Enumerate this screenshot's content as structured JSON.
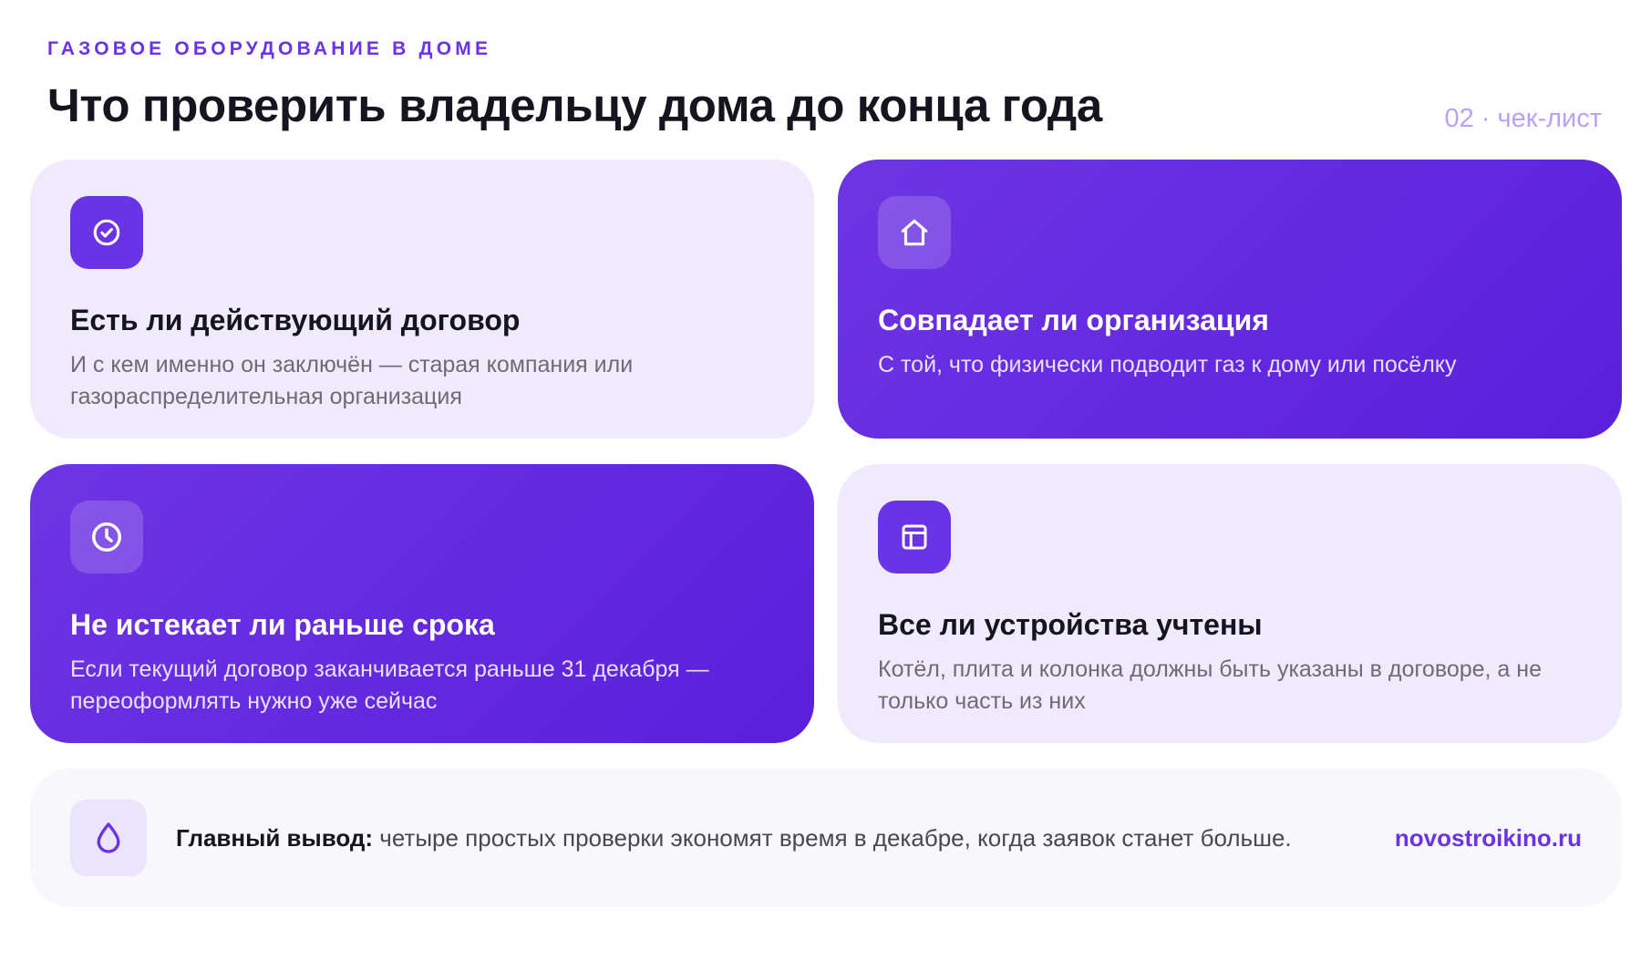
{
  "header": {
    "kicker": "ГАЗОВОЕ ОБОРУДОВАНИЕ В ДОМЕ",
    "title": "Что проверить владельцу дома до конца года",
    "page_indicator": "02 · чек-лист"
  },
  "cards": [
    {
      "icon": "check-circle-icon",
      "title": "Есть ли действующий договор",
      "description": "И с кем именно он заключён — старая компания или газораспределительная организация"
    },
    {
      "icon": "home-icon",
      "title": "Совпадает ли организация",
      "description": "С той, что физически подводит газ к дому или посёлку"
    },
    {
      "icon": "clock-icon",
      "title": "Не истекает ли раньше срока",
      "description": "Если текущий договор заканчивается раньше 31 декабря — переоформлять нужно уже сейчас"
    },
    {
      "icon": "layout-icon",
      "title": "Все ли устройства учтены",
      "description": "Котёл, плита и колонка должны быть указаны в договоре, а не только часть из них"
    }
  ],
  "conclusion": {
    "icon": "drop-icon",
    "label": "Главный вывод:",
    "text": " четыре простых проверки экономят время в декабре, когда заявок станет больше.",
    "site": "novostroikino.ru"
  },
  "colors": {
    "accent": "#6a33e6",
    "card_light": "#efebfc",
    "card_dark_start": "#6e35e3",
    "card_dark_end": "#5a1fdc",
    "muted": "#b6a4f2"
  }
}
